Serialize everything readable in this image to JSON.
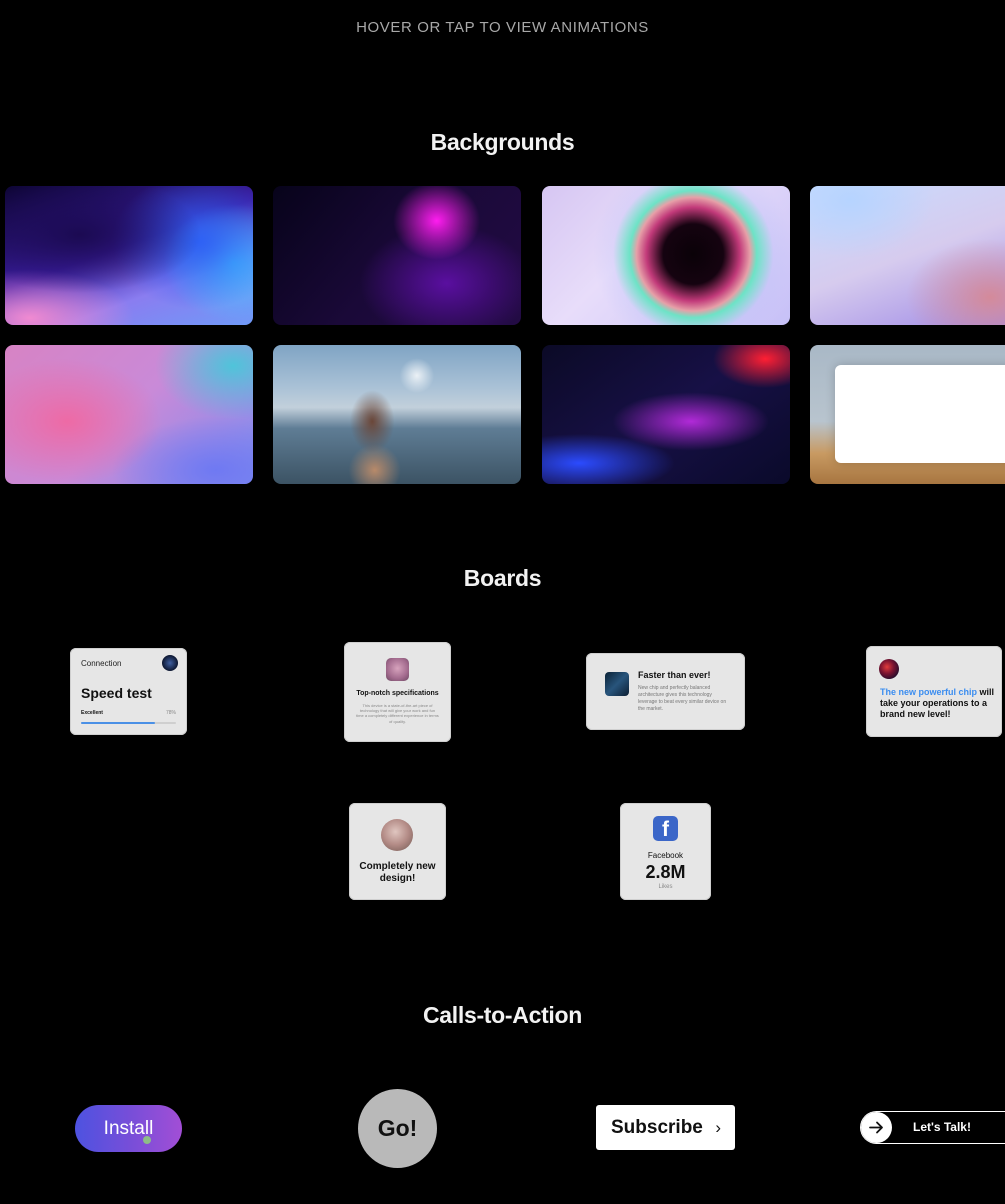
{
  "hint": "HOVER OR TAP TO VIEW ANIMATIONS",
  "sections": {
    "backgrounds": "Backgrounds",
    "boards": "Boards",
    "ctas": "Calls-to-Action"
  },
  "boards": {
    "speed": {
      "label": "Connection",
      "title": "Speed test",
      "quality": "Excellent",
      "percent_text": "78%",
      "progress": 0.78
    },
    "specs": {
      "title": "Top-notch specifications",
      "desc": "This device is a state-of-the-art piece of technology that will give your work and fun time a completely different experience in terms of quality."
    },
    "faster": {
      "title": "Faster than ever!",
      "desc": "New chip and perfectly balanced architecture gives this technology leverage to beat every similar device on the market."
    },
    "chip": {
      "accent": "The new powerful chip",
      "rest": "will take your operations to a brand new level!"
    },
    "design": {
      "title": "Completely new design!"
    },
    "facebook": {
      "icon": "f",
      "name": "Facebook",
      "count": "2.8M",
      "unit": "Likes"
    }
  },
  "ctas": {
    "install": "Install",
    "go": "Go!",
    "subscribe": "Subscribe",
    "subscribe_chevron": "›",
    "talk": "Let's Talk!"
  }
}
